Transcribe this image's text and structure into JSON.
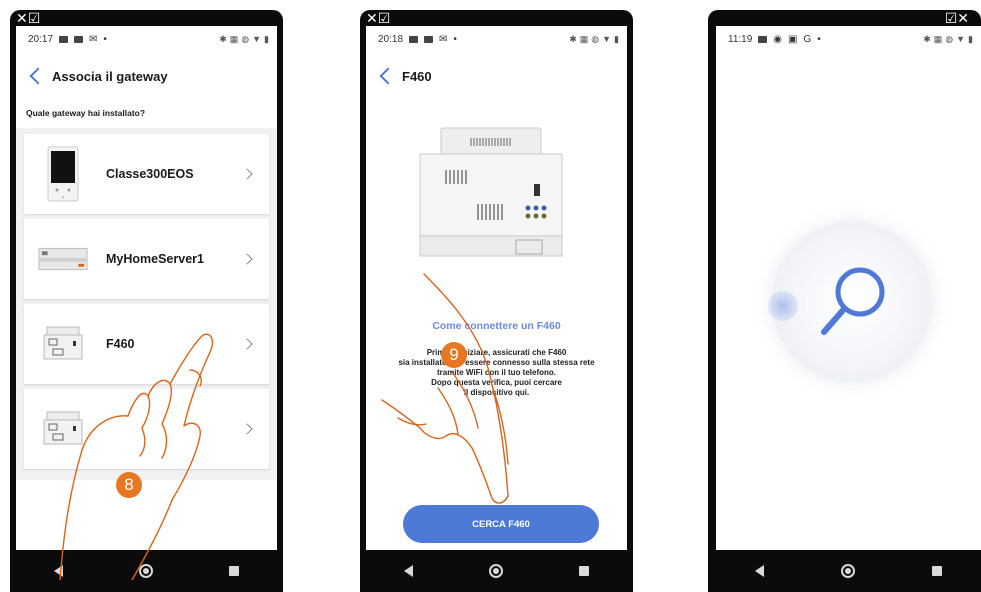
{
  "screens": [
    {
      "top_icons": "✕☑",
      "status_time": "20:17",
      "status_dot": "•",
      "header_title": "Associa il gateway",
      "question": "Quale gateway hai installato?",
      "gateways": [
        {
          "label": "Classe300EOS"
        },
        {
          "label": "MyHomeServer1"
        },
        {
          "label": "F460"
        },
        {
          "label": ""
        }
      ],
      "step_badge": "8"
    },
    {
      "top_icons": "✕☑",
      "status_time": "20:18",
      "status_dot": "•",
      "header_title": "F460",
      "heading": "Come connettere un F460",
      "instructions": [
        "Prima di iniziare, assicurati che F460",
        "sia installato e di essere connesso sulla stessa rete",
        "tramite WiFi con il tuo telefono.",
        "Dopo questa verifica, puoi cercare",
        "il dispositivo qui."
      ],
      "button_label": "CERCA F460",
      "step_badge": "9"
    },
    {
      "top_icons": "☑✕",
      "status_time": "11:19",
      "status_dot": "•"
    }
  ],
  "colors": {
    "accent": "#4f79d7",
    "heading_blue": "#6a8be0",
    "badge_orange": "#e87722",
    "hand_orange": "#d9641c"
  }
}
